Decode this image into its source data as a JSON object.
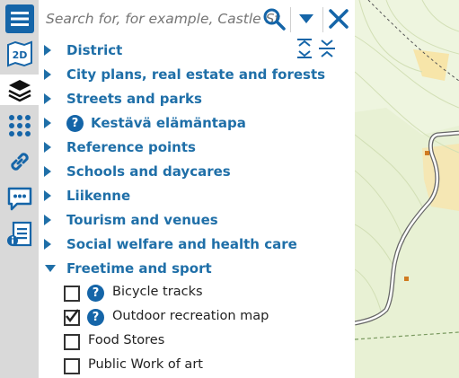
{
  "toolbar": {
    "tools": [
      {
        "name": "menu-icon"
      },
      {
        "name": "map-2d-icon",
        "text": "2D"
      },
      {
        "name": "layers-icon"
      },
      {
        "name": "apps-grid-icon"
      },
      {
        "name": "link-icon"
      },
      {
        "name": "feedback-icon"
      },
      {
        "name": "info-legend-icon"
      }
    ]
  },
  "search": {
    "placeholder": "Search for, for example, Castle St"
  },
  "layers": {
    "items": [
      {
        "label": "District",
        "expanded": false,
        "help": false
      },
      {
        "label": "City plans, real estate and forests",
        "expanded": false,
        "help": false
      },
      {
        "label": "Streets and parks",
        "expanded": false,
        "help": false
      },
      {
        "label": "Kestävä elämäntapa",
        "expanded": false,
        "help": true
      },
      {
        "label": "Reference points",
        "expanded": false,
        "help": false
      },
      {
        "label": "Schools and daycares",
        "expanded": false,
        "help": false
      },
      {
        "label": "Liikenne",
        "expanded": false,
        "help": false
      },
      {
        "label": "Tourism and venues",
        "expanded": false,
        "help": false
      },
      {
        "label": "Social welfare and health care",
        "expanded": false,
        "help": false
      },
      {
        "label": "Freetime and sport",
        "expanded": true,
        "help": false
      }
    ],
    "sublayers": [
      {
        "label": "Bicycle tracks",
        "checked": false,
        "help": true
      },
      {
        "label": "Outdoor recreation map",
        "checked": true,
        "help": true
      },
      {
        "label": "Food Stores",
        "checked": false,
        "help": false
      },
      {
        "label": "Public Work of art",
        "checked": false,
        "help": false
      }
    ],
    "help_glyph": "?"
  },
  "colors": {
    "accent": "#1f6fa8",
    "sidebar": "#d9d9d9",
    "map_background": "#e9f2d6",
    "map_light": "#f6f9ec",
    "map_yellow": "#f8e4a0"
  }
}
